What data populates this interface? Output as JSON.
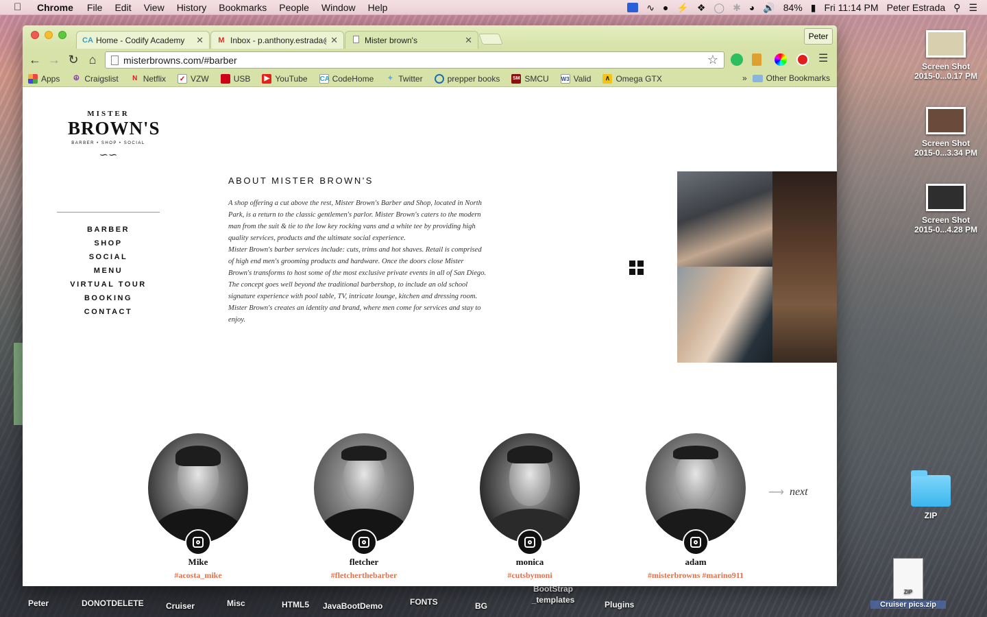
{
  "menubar": {
    "app": "Chrome",
    "items": [
      "File",
      "Edit",
      "View",
      "History",
      "Bookmarks",
      "People",
      "Window",
      "Help"
    ],
    "battery": "84%",
    "clock": "Fri 11:14 PM",
    "user": "Peter Estrada"
  },
  "browser": {
    "tabs": [
      {
        "favicon": "CA",
        "title": "Home - Codify Academy"
      },
      {
        "favicon": "M",
        "title": "Inbox - p.anthony.estrada@"
      },
      {
        "favicon": "",
        "title": "Mister brown's"
      }
    ],
    "profile": "Peter",
    "url": "misterbrowns.com/#barber",
    "bookmarks": [
      {
        "icon": "apps",
        "label": "Apps"
      },
      {
        "icon": "peace",
        "label": "Craigslist"
      },
      {
        "icon": "N",
        "label": "Netflix"
      },
      {
        "icon": "vzw",
        "label": "VZW"
      },
      {
        "icon": "usb",
        "label": "USB"
      },
      {
        "icon": "yt",
        "label": "YouTube"
      },
      {
        "icon": "CA",
        "label": "CodeHome"
      },
      {
        "icon": "bird",
        "label": "Twitter"
      },
      {
        "icon": "globe",
        "label": "prepper books"
      },
      {
        "icon": "SM",
        "label": "SMCU"
      },
      {
        "icon": "W3",
        "label": "Valid"
      },
      {
        "icon": "omega",
        "label": "Omega GTX"
      }
    ],
    "other_bookmarks": "Other Bookmarks",
    "chevron": "»"
  },
  "site": {
    "logo": {
      "top": "MISTER",
      "main": "BROWN'S",
      "tagline": "BARBER • SHOP • SOCIAL",
      "flourish": "∽∽"
    },
    "nav": [
      "BARBER",
      "SHOP",
      "SOCIAL",
      "MENU",
      "VIRTUAL TOUR",
      "BOOKING",
      "CONTACT"
    ],
    "about_title": "ABOUT MISTER BROWN'S",
    "about_paragraphs": [
      "A shop offering a cut above the rest,  Mister Brown's Barber and Shop, located in North Park, is a return to the classic gentlemen's parlor. Mister Brown's  caters to the modern man from the suit & tie to the low key rocking vans and a white tee by providing high quality services, products and the ultimate social experience.",
      "Mister Brown's barber services include: cuts, trims and hot shaves. Retail is comprised of high end men's grooming products and hardware. Once the doors close Mister Brown's transforms to host some of the most exclusive private events in all of San Diego.",
      "The concept goes well beyond the traditional barbershop, to include an old school signature experience with pool table, TV, intricate lounge, kitchen and dressing room. Mister Brown's creates an identity and brand, where men come for services and stay to enjoy."
    ],
    "team": [
      {
        "name": "Mike",
        "handle": "#acosta_mike"
      },
      {
        "name": "fletcher",
        "handle": "#fletcherthebarber"
      },
      {
        "name": "monica",
        "handle": "#cutsbymoni"
      },
      {
        "name": "adam",
        "handle": "#misterbrowns #marino911"
      }
    ],
    "next_label": "next",
    "accent_color": "#e0724f"
  },
  "desktop": {
    "screenshots": [
      {
        "line1": "Screen Shot",
        "line2": "2015-0...0.17 PM"
      },
      {
        "line1": "Screen Shot",
        "line2": "2015-0...3.34 PM"
      },
      {
        "line1": "Screen Shot",
        "line2": "2015-0...4.28 PM"
      }
    ],
    "folder": "ZIP",
    "zip_file": "Cruiser pics.zip",
    "zip_badge": "ZIP",
    "dock_labels": [
      "Peter",
      "DONOTDELETE",
      "Cruiser",
      "Misc",
      "HTML5",
      "JavaBootDemo",
      "FONTS",
      "BG",
      "BootStrap _templates",
      "Plugins"
    ]
  }
}
